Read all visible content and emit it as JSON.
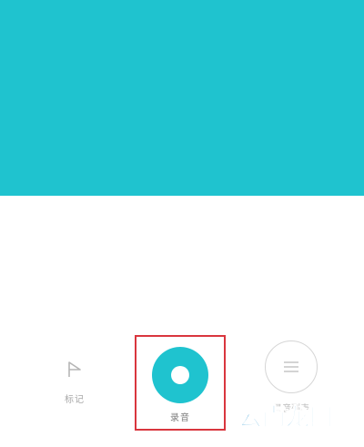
{
  "screen": {
    "accent_color": "#1fc3cf",
    "highlight_color": "#d9363e"
  },
  "controls": {
    "mark": {
      "icon": "flag-icon",
      "label": "标记"
    },
    "record": {
      "icon": "record-icon",
      "label": "录音"
    },
    "list": {
      "icon": "list-icon",
      "label": "录音列表"
    }
  },
  "watermark": {
    "text": "云南龙网",
    "color": "#3fa2d8"
  }
}
